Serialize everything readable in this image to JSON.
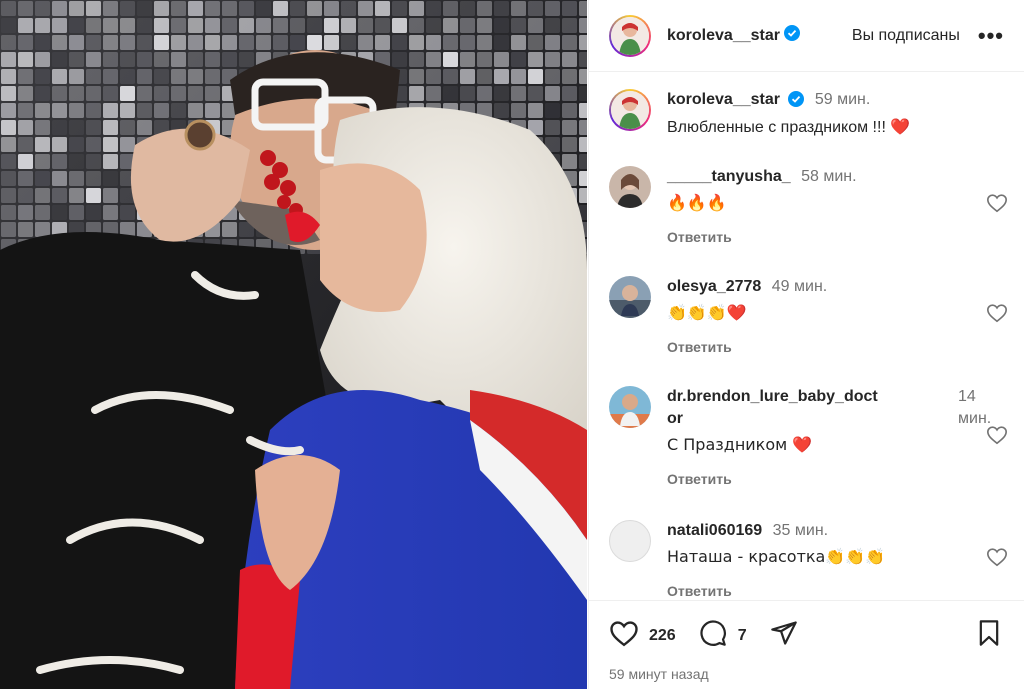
{
  "post": {
    "author": "koroleva__star",
    "verified": true,
    "follow_status": "Вы подписаны",
    "more_icon": "more-horizontal-icon",
    "caption": {
      "username": "koroleva__star",
      "time": "59 мин.",
      "text": "Влюбленные с праздником !!!",
      "emoji": "❤️"
    }
  },
  "comments": [
    {
      "username": "_____tanyusha_",
      "time": "58 мин.",
      "text": "🔥🔥🔥",
      "reply_label": "Ответить",
      "avatar_color": "#c9b6a9"
    },
    {
      "username": "olesya_2778",
      "time": "49 мин.",
      "text": "👏👏👏❤️",
      "reply_label": "Ответить",
      "avatar_color": "#8aa0b4"
    },
    {
      "username": "dr.brendon_lure_baby_doct",
      "username_cont": "or",
      "time": "14",
      "time_cont": "мин.",
      "text": "С Праздником ❤️",
      "reply_label": "Ответить",
      "avatar_color": "#7fb8d6"
    },
    {
      "username": "natali060169",
      "time": "35 мин.",
      "text": "Наташа - красотка👏👏👏",
      "reply_label": "Ответить",
      "avatar_color": "#efefef"
    }
  ],
  "actions": {
    "likes": "226",
    "comments": "7",
    "posted_ago": "59 минут назад"
  },
  "colors": {
    "text": "#262626",
    "secondary": "#737373",
    "verified_blue": "#0095f6",
    "heart_red": "#ed1c24"
  }
}
